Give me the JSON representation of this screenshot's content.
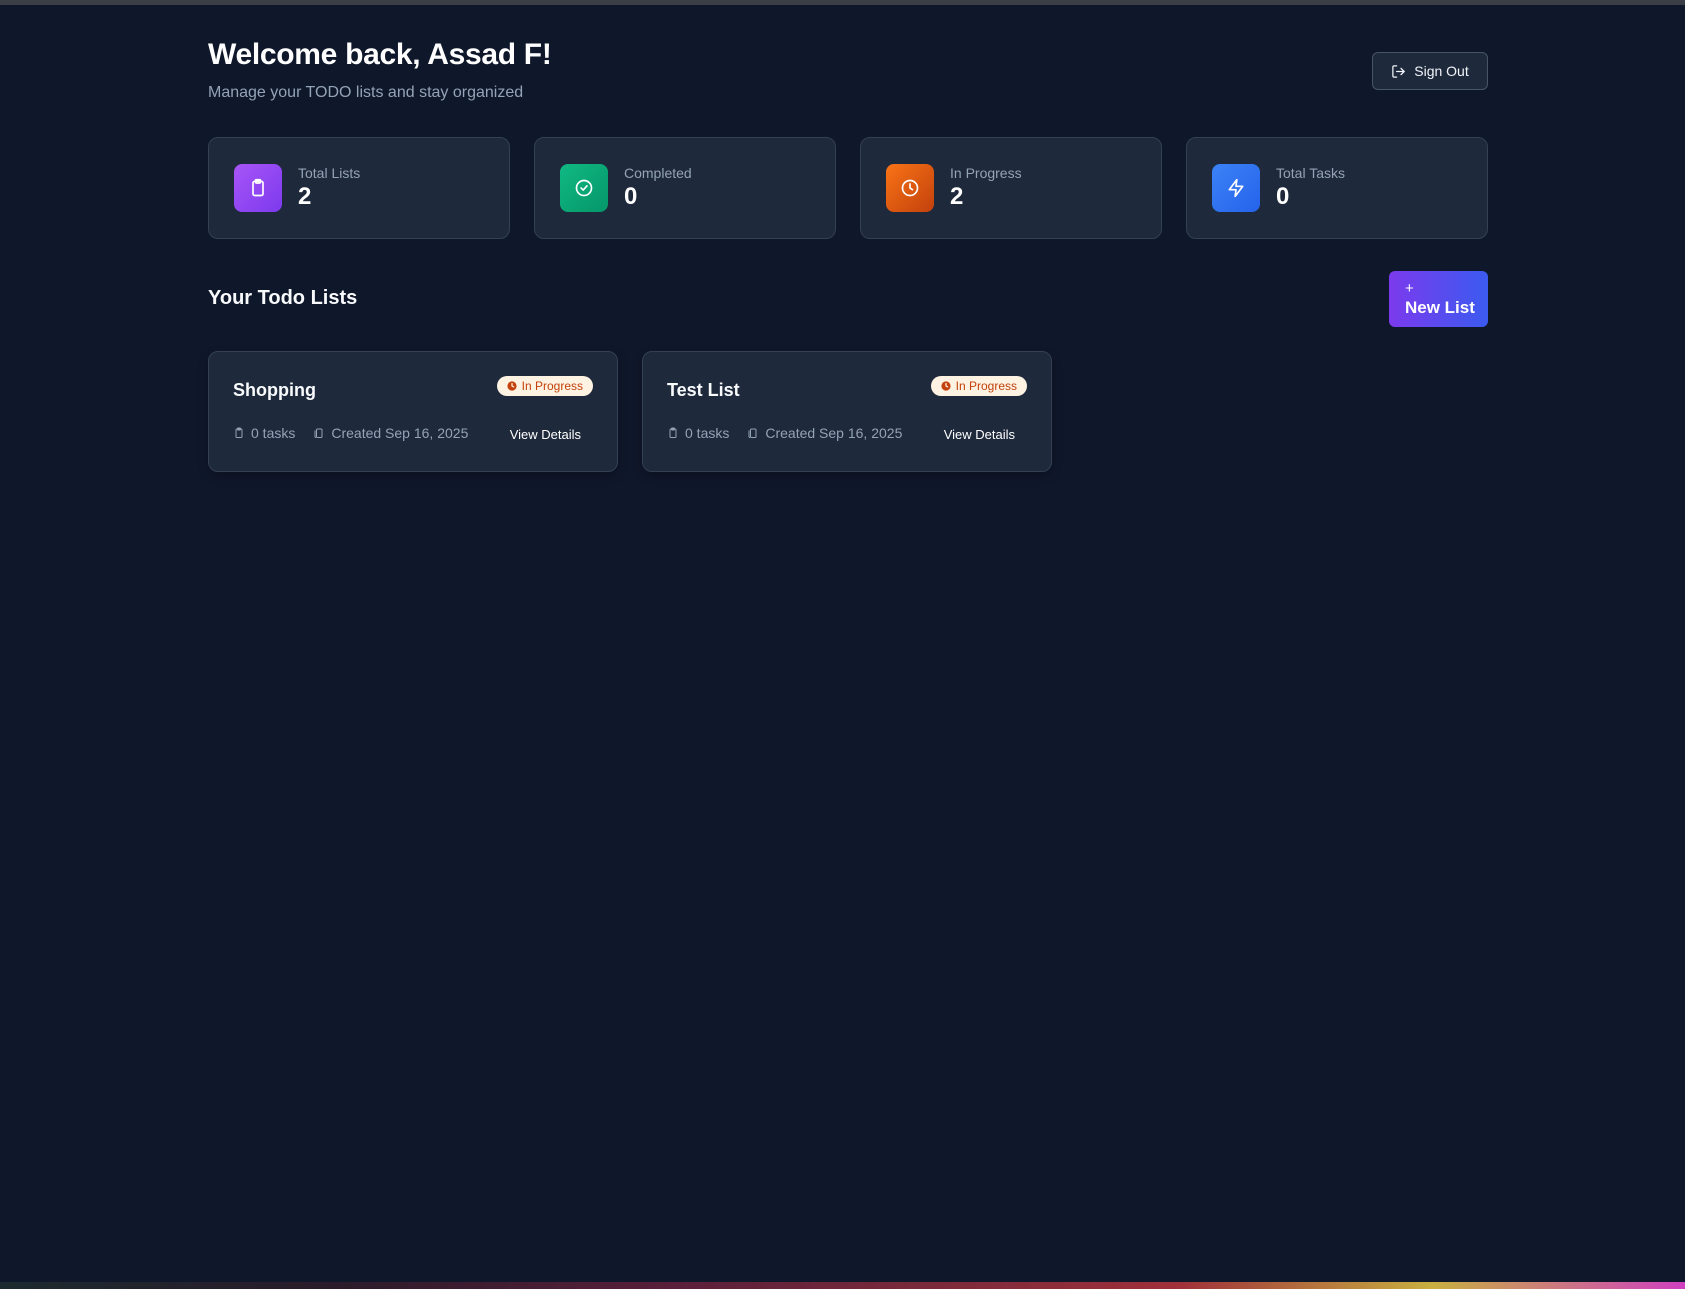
{
  "header": {
    "title": "Welcome back, Assad F!",
    "subtitle": "Manage your TODO lists and stay organized",
    "sign_out_label": "Sign Out"
  },
  "stats": [
    {
      "label": "Total Lists",
      "value": "2",
      "icon": "clipboard-icon",
      "color_from": "#a855f7",
      "color_to": "#7c3aed"
    },
    {
      "label": "Completed",
      "value": "0",
      "icon": "check-circle-icon",
      "color_from": "#10b981",
      "color_to": "#059669"
    },
    {
      "label": "In Progress",
      "value": "2",
      "icon": "clock-icon",
      "color_from": "#f97316",
      "color_to": "#c2410c"
    },
    {
      "label": "Total Tasks",
      "value": "0",
      "icon": "lightning-icon",
      "color_from": "#3b82f6",
      "color_to": "#2563eb"
    }
  ],
  "lists_section": {
    "title": "Your Todo Lists",
    "new_list_plus": "+",
    "new_list_label": "New List"
  },
  "todo_lists": [
    {
      "title": "Shopping",
      "status": "In Progress",
      "tasks": "0 tasks",
      "created": "Created Sep 16, 2025",
      "action": "View Details"
    },
    {
      "title": "Test List",
      "status": "In Progress",
      "tasks": "0 tasks",
      "created": "Created Sep 16, 2025",
      "action": "View Details"
    }
  ]
}
